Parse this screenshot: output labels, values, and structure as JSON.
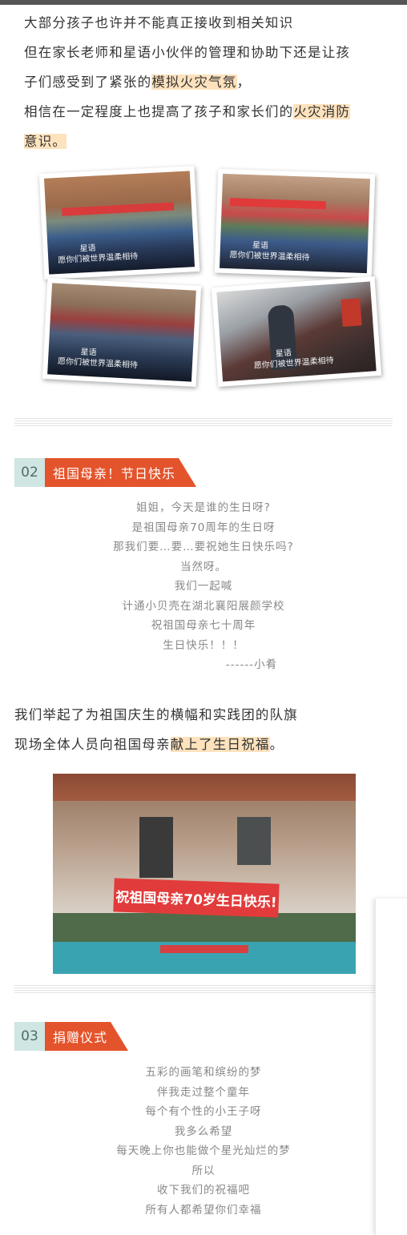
{
  "intro": {
    "lines": [
      {
        "text": "大部分孩子也许并不能真正接收到相关知识"
      },
      {
        "text": "但在家长老师和星语小伙伴的管理和协助下还是让孩"
      },
      {
        "pre": "子们感受到了紧张的",
        "hl": "模拟火灾气氛",
        "post": "，"
      },
      {
        "pre": "相信在一定程度上也提高了孩子和家长们的",
        "hl": "火灾消防",
        "post": ""
      },
      {
        "pre": "",
        "hl": "意识。",
        "post": ""
      }
    ]
  },
  "photo_caption": {
    "line1": "星语",
    "line2": "愿你们被世界温柔相待"
  },
  "section2": {
    "number": "02",
    "title": "祖国母亲！节日快乐",
    "poem": [
      "姐姐，今天是谁的生日呀?",
      "是祖国母亲70周年的生日呀",
      "那我们要…要…要祝她生日快乐吗?",
      "当然呀。",
      "我们一起喊",
      "计通小贝壳在湖北襄阳展颜学校",
      "祝祖国母亲七十周年",
      "生日快乐！！！"
    ],
    "signature": "------小肴",
    "para": [
      {
        "pre": "我们举起了为祖国庆生的横幅和实践团的队旗",
        "hl": "",
        "post": ""
      },
      {
        "pre": "现场全体人员向祖国母亲",
        "hl": "献上了生日祝福",
        "post": "。"
      }
    ],
    "banner_text": "祝祖国母亲70岁生日快乐!"
  },
  "section3": {
    "number": "03",
    "title": "捐赠仪式",
    "poem": [
      "五彩的画笔和缤纷的梦",
      "伴我走过整个童年",
      "每个有个性的小王子呀",
      "我多么希望",
      "每天晚上你也能做个星光灿烂的梦",
      "所以",
      "收下我们的祝福吧",
      "所有人都希望你们幸福"
    ]
  },
  "colors": {
    "accent": "#e4542c",
    "number_bg": "#cfe6e2",
    "highlight": "#fde2bd"
  }
}
